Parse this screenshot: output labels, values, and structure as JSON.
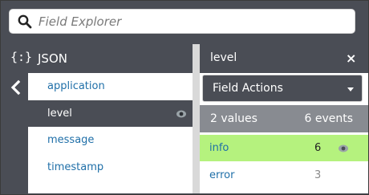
{
  "search": {
    "placeholder": "Field Explorer"
  },
  "left_panel": {
    "braces": "{:}",
    "title": "JSON",
    "fields": [
      {
        "label": "application",
        "active": false
      },
      {
        "label": "level",
        "active": true
      },
      {
        "label": "message",
        "active": false
      },
      {
        "label": "timestamp",
        "active": false
      }
    ]
  },
  "right_panel": {
    "field_name": "level",
    "close_glyph": "×",
    "actions_label": "Field Actions",
    "stats": {
      "values": "2 values",
      "events": "6 events"
    },
    "values": [
      {
        "name": "info",
        "count": "6",
        "highlighted": true
      },
      {
        "name": "error",
        "count": "3",
        "highlighted": false
      }
    ]
  },
  "colors": {
    "panel_dark": "#4a4d55",
    "stats_gray": "#888b91",
    "link_blue": "#1f6fa8",
    "highlight_green": "#b5f27e"
  },
  "icons": [
    "search-icon",
    "back-chevron-icon",
    "eye-icon",
    "close-icon",
    "dropdown-caret-icon"
  ]
}
